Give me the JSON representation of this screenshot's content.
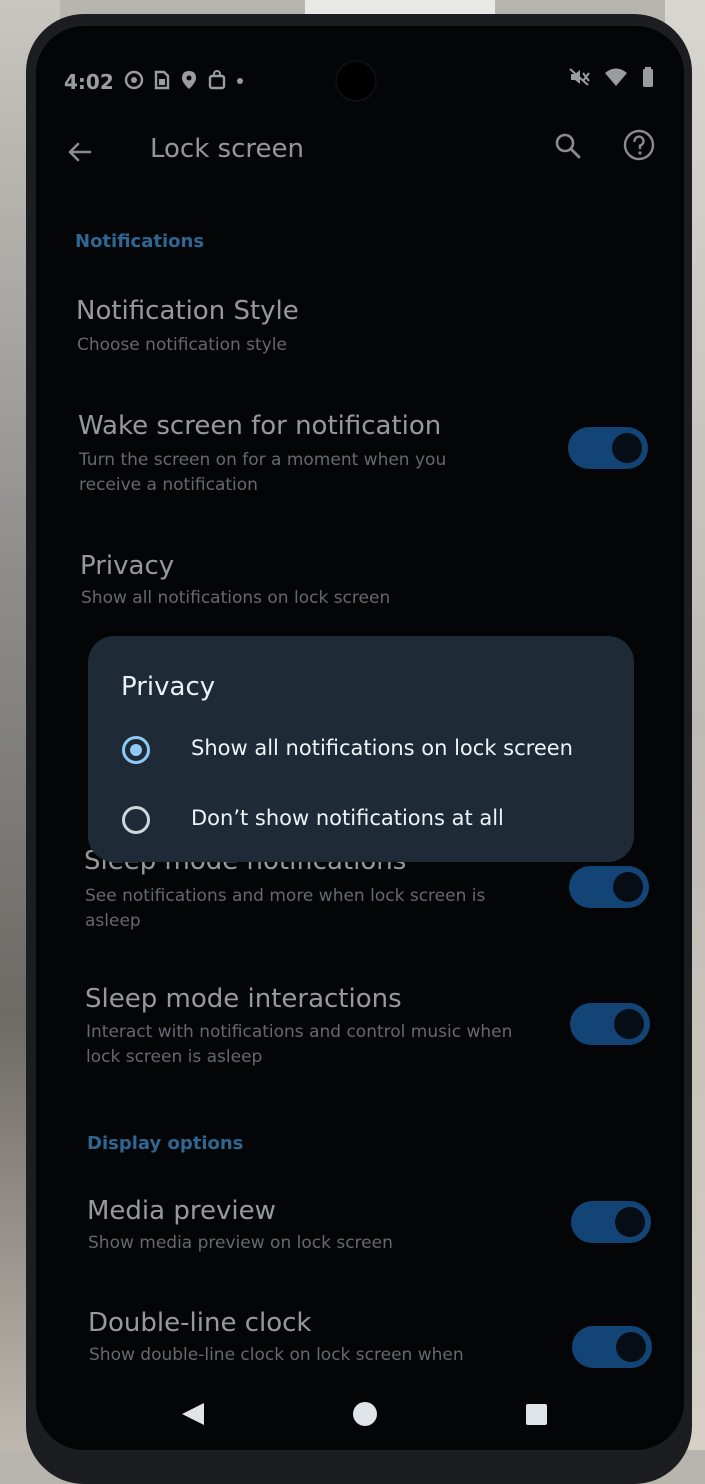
{
  "status_bar": {
    "time": "4:02",
    "icons": [
      "whatsapp-icon",
      "sim-icon",
      "maps-pin-icon",
      "shopping-bag-icon",
      "dot-icon"
    ],
    "right_icons": [
      "mute-icon",
      "wifi-icon",
      "battery-icon"
    ]
  },
  "app_bar": {
    "title": "Lock screen",
    "back_icon": "arrow-back-icon",
    "search_icon": "search-icon",
    "help_icon": "help-icon"
  },
  "sections": {
    "notifications": "Notifications",
    "display_options": "Display options"
  },
  "settings": [
    {
      "title": "Notification Style",
      "subtitle": "Choose notification style",
      "toggle": null
    },
    {
      "title": "Wake screen for notification",
      "subtitle": "Turn the screen on for a moment when you receive a notification",
      "toggle": true
    },
    {
      "title": "Privacy",
      "subtitle": "Show all notifications on lock screen",
      "toggle": null
    },
    {
      "title": "Sleep mode notifications",
      "subtitle": "See notifications and more when lock screen is asleep",
      "toggle": true
    },
    {
      "title": "Sleep mode interactions",
      "subtitle": "Interact with notifications and control music when lock screen is asleep",
      "toggle": true
    },
    {
      "title": "Media preview",
      "subtitle": "Show media preview on lock screen",
      "toggle": true
    },
    {
      "title": "Double-line clock",
      "subtitle": "Show double-line clock on lock screen when",
      "toggle": true
    }
  ],
  "dialog": {
    "title": "Privacy",
    "options": [
      {
        "label": "Show all notifications on lock screen",
        "selected": true
      },
      {
        "label": "Don’t show notifications at all",
        "selected": false
      }
    ]
  },
  "nav_bar": {
    "icons": [
      "back-triangle-icon",
      "home-circle-icon",
      "recents-square-icon"
    ]
  },
  "colors": {
    "accent": "#4a9de0",
    "toggle_on": "#1c69b4",
    "dialog_bg": "#1e2a36",
    "screen_bg": "#06080b"
  }
}
